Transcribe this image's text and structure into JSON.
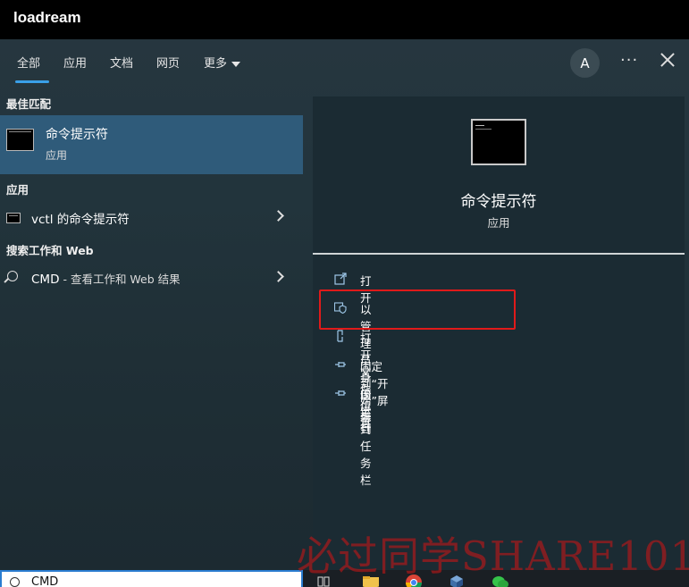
{
  "window": {
    "title": "loadream"
  },
  "tabs": [
    {
      "label": "全部"
    },
    {
      "label": "应用"
    },
    {
      "label": "文档"
    },
    {
      "label": "网页"
    },
    {
      "label": "更多"
    }
  ],
  "header": {
    "avatar_letter": "A",
    "more_label": "···"
  },
  "left": {
    "best_match_heading": "最佳匹配",
    "best_match": {
      "name": "命令提示符",
      "type": "应用",
      "icon": "command-prompt-icon"
    },
    "apps_heading": "应用",
    "apps": [
      {
        "label": "vctl 的命令提示符",
        "icon": "command-prompt-icon"
      }
    ],
    "web_heading": "搜索工作和 Web",
    "web": [
      {
        "label": "CMD",
        "suffix": " - 查看工作和 Web 结果",
        "icon": "search-icon"
      }
    ]
  },
  "detail": {
    "title": "命令提示符",
    "subtitle": "应用",
    "actions": [
      {
        "label": "打开",
        "icon": "open-icon"
      },
      {
        "label": "以管理员身份运行",
        "icon": "shield-icon"
      },
      {
        "label": "打开文件位置",
        "icon": "folder-icon"
      },
      {
        "label": "固定到“开始”屏幕",
        "icon": "pin-icon"
      },
      {
        "label": "固定到任务栏",
        "icon": "pin-icon"
      }
    ],
    "highlight_color": "#e01a1a"
  },
  "search": {
    "value": "CMD"
  },
  "taskbar": {
    "apps": [
      "task-view-icon",
      "file-explorer-icon",
      "chrome-icon",
      "virtualbox-icon",
      "wechat-icon"
    ]
  },
  "watermark": "必过同学SHARE101",
  "colors": {
    "accent": "#3aa0e8",
    "selected": "#2f5b7a"
  }
}
